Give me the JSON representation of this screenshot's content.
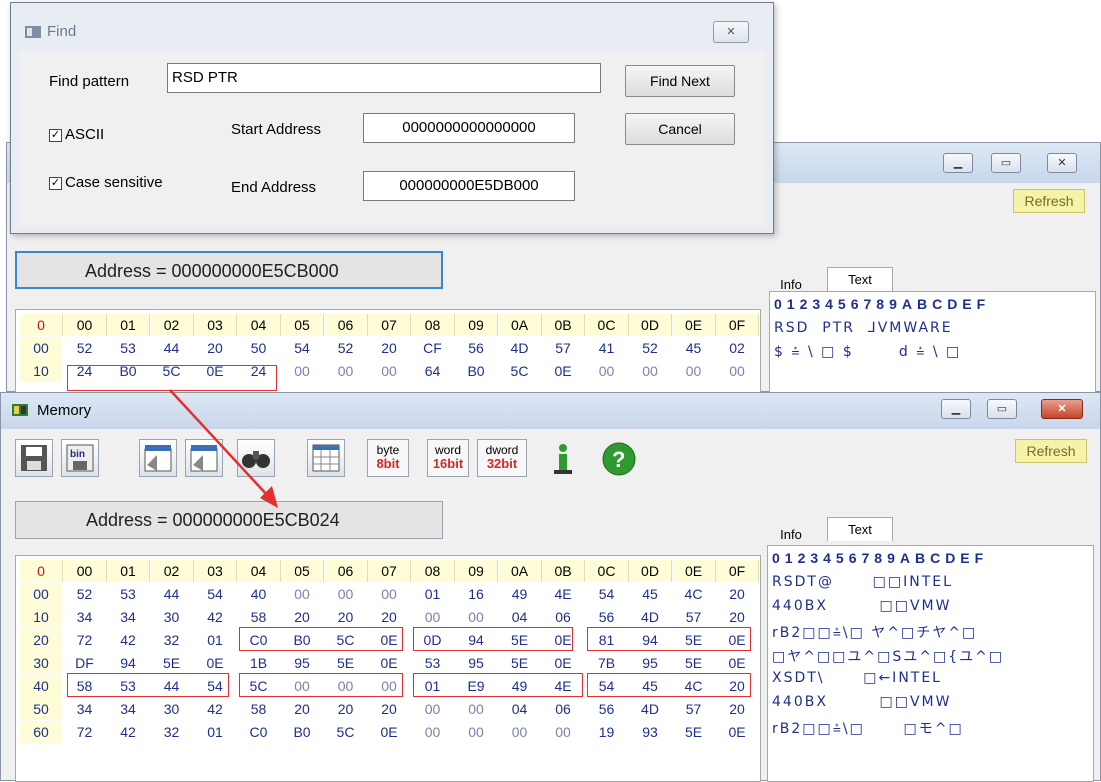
{
  "find_dialog": {
    "title": "Find",
    "pattern_label": "Find pattern",
    "pattern_value": "RSD PTR",
    "ascii_label": "ASCII",
    "case_label": "Case sensitive",
    "start_label": "Start Address",
    "start_value": "0000000000000000",
    "end_label": "End Address",
    "end_value": "000000000E5DB000",
    "find_next": "Find Next",
    "cancel": "Cancel",
    "close_glyph": "✕"
  },
  "back_window": {
    "refresh": "Refresh",
    "address": "Address = 000000000E5CB000",
    "tab_info": "Info",
    "tab_text": "Text",
    "ascii_header": "0123456789ABCDEF",
    "header_row": [
      "0",
      "00",
      "01",
      "02",
      "03",
      "04",
      "05",
      "06",
      "07",
      "08",
      "09",
      "0A",
      "0B",
      "0C",
      "0D",
      "0E",
      "0F"
    ],
    "rows": [
      {
        "label": "00",
        "cells": [
          "52",
          "53",
          "44",
          "20",
          "50",
          "54",
          "52",
          "20",
          "CF",
          "56",
          "4D",
          "57",
          "41",
          "52",
          "45",
          "02"
        ],
        "ascii": "RSD  PTR  ⅃VMWARE"
      },
      {
        "label": "10",
        "cells": [
          "24",
          "B0",
          "5C",
          "0E",
          "24",
          "00",
          "00",
          "00",
          "64",
          "B0",
          "5C",
          "0E",
          "00",
          "00",
          "00",
          "00"
        ],
        "ascii": "$ ⩮ \\ □ $       d ⩮ \\ □"
      }
    ]
  },
  "memory_window": {
    "title": "Memory",
    "refresh": "Refresh",
    "tb_byte_top": "byte",
    "tb_byte_bot": "8bit",
    "tb_word_top": "word",
    "tb_word_bot": "16bit",
    "tb_dword_top": "dword",
    "tb_dword_bot": "32bit",
    "address": "Address = 000000000E5CB024",
    "tab_info": "Info",
    "tab_text": "Text",
    "ascii_header": "0123456789ABCDEF",
    "header_row": [
      "0",
      "00",
      "01",
      "02",
      "03",
      "04",
      "05",
      "06",
      "07",
      "08",
      "09",
      "0A",
      "0B",
      "0C",
      "0D",
      "0E",
      "0F"
    ],
    "rows": [
      {
        "label": "00",
        "cells": [
          "52",
          "53",
          "44",
          "54",
          "40",
          "00",
          "00",
          "00",
          "01",
          "16",
          "49",
          "4E",
          "54",
          "45",
          "4C",
          "20"
        ],
        "ascii": "RSDT@      □□INTEL"
      },
      {
        "label": "10",
        "cells": [
          "34",
          "34",
          "30",
          "42",
          "58",
          "20",
          "20",
          "20",
          "00",
          "00",
          "04",
          "06",
          "56",
          "4D",
          "57",
          "20"
        ],
        "ascii": "440BX        □□VMW"
      },
      {
        "label": "20",
        "cells": [
          "72",
          "42",
          "32",
          "01",
          "C0",
          "B0",
          "5C",
          "0E",
          "0D",
          "94",
          "5E",
          "0E",
          "81",
          "94",
          "5E",
          "0E"
        ],
        "ascii": "rB2□□⩮\\□ ヤ^□チヤ^□"
      },
      {
        "label": "30",
        "cells": [
          "DF",
          "94",
          "5E",
          "0E",
          "1B",
          "95",
          "5E",
          "0E",
          "53",
          "95",
          "5E",
          "0E",
          "7B",
          "95",
          "5E",
          "0E"
        ],
        "ascii": "□ヤ^□□ユ^□Sユ^□{ユ^□"
      },
      {
        "label": "40",
        "cells": [
          "58",
          "53",
          "44",
          "54",
          "5C",
          "00",
          "00",
          "00",
          "01",
          "E9",
          "49",
          "4E",
          "54",
          "45",
          "4C",
          "20"
        ],
        "ascii": "XSDT\\      □←INTEL"
      },
      {
        "label": "50",
        "cells": [
          "34",
          "34",
          "30",
          "42",
          "58",
          "20",
          "20",
          "20",
          "00",
          "00",
          "04",
          "06",
          "56",
          "4D",
          "57",
          "20"
        ],
        "ascii": "440BX        □□VMW"
      },
      {
        "label": "60",
        "cells": [
          "72",
          "42",
          "32",
          "01",
          "C0",
          "B0",
          "5C",
          "0E",
          "00",
          "00",
          "00",
          "00",
          "19",
          "93",
          "5E",
          "0E"
        ],
        "ascii": "rB2□□⩮\\□      □モ^□"
      }
    ]
  },
  "colors": {
    "accent": "#3b86c9",
    "highlight": "#e03030",
    "hex_text": "#1f2f8c",
    "header_bg": "#fffdd8"
  }
}
